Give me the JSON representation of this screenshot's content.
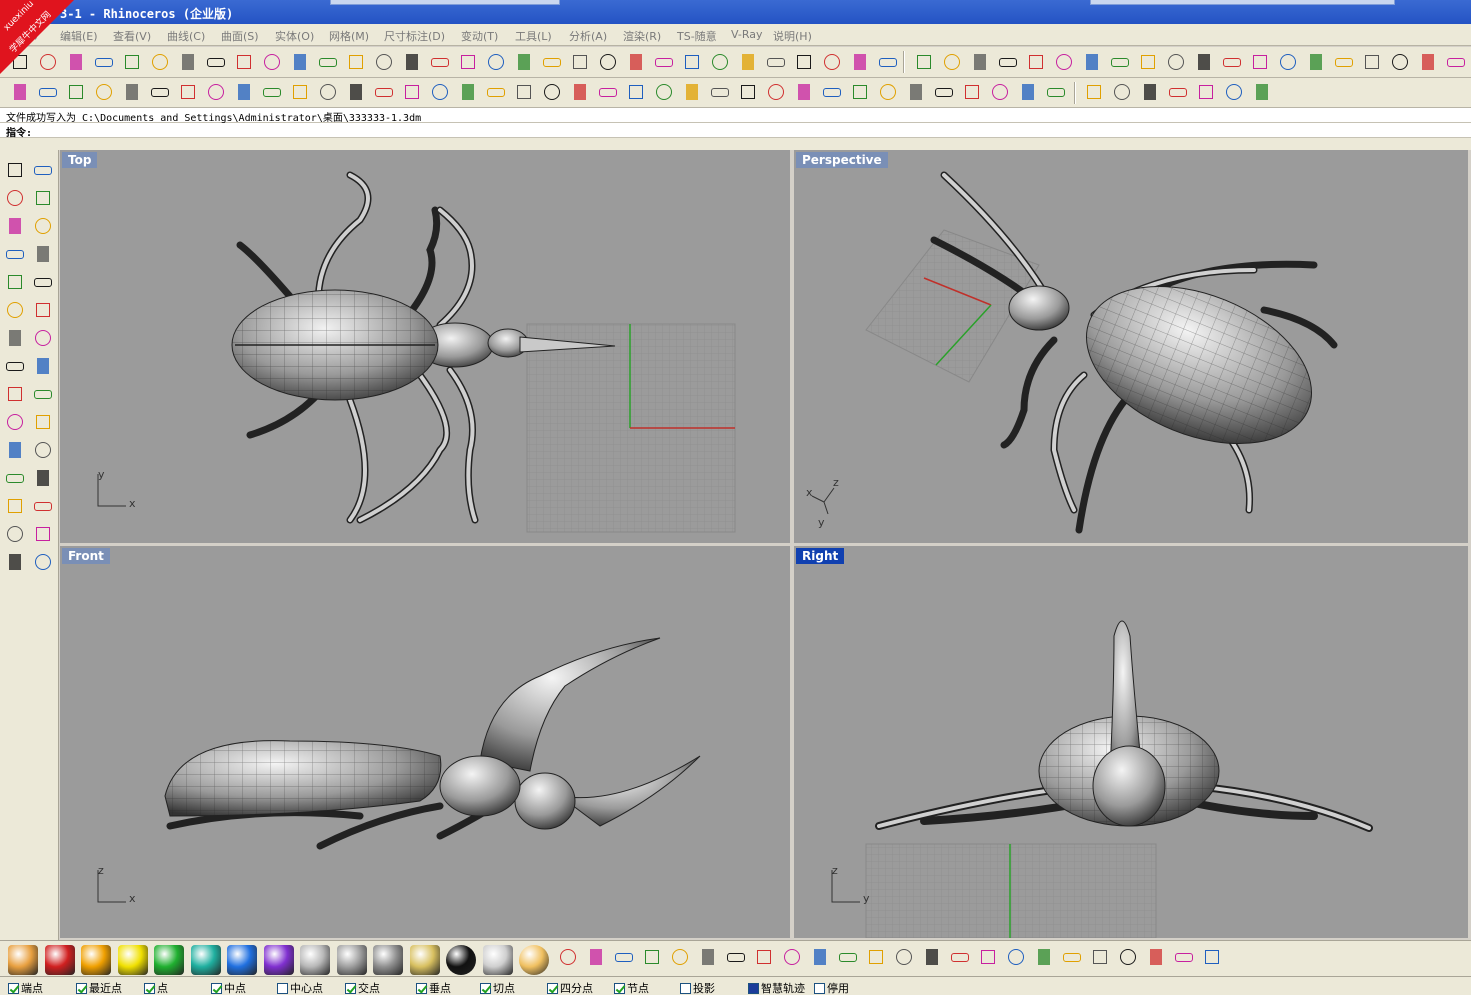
{
  "window": {
    "title": "3-1 - Rhinoceros (企业版)",
    "watermark": {
      "site": "xuexiniu",
      "name": "学犀牛中文网"
    }
  },
  "menu": [
    {
      "label": "编辑(E)"
    },
    {
      "label": "查看(V)"
    },
    {
      "label": "曲线(C)"
    },
    {
      "label": "曲面(S)"
    },
    {
      "label": "实体(O)"
    },
    {
      "label": "网格(M)"
    },
    {
      "label": "尺寸标注(D)"
    },
    {
      "label": "变动(T)"
    },
    {
      "label": "工具(L)"
    },
    {
      "label": "分析(A)"
    },
    {
      "label": "渲染(R)"
    },
    {
      "label": "TS-随意"
    },
    {
      "label": "V-Ray"
    },
    {
      "label": "说明(H)"
    }
  ],
  "command_history": "文件成功写入为 C:\\Documents and Settings\\Administrator\\桌面\\333333-1.3dm",
  "command_prompt": "指令:",
  "viewports": {
    "top": {
      "label": "Top",
      "axis_v": "y",
      "axis_h": "x"
    },
    "perspective": {
      "label": "Perspective",
      "axis_z": "z",
      "axis_x": "x",
      "axis_y": "y"
    },
    "front": {
      "label": "Front",
      "axis_v": "z",
      "axis_h": "x"
    },
    "right": {
      "label": "Right",
      "axis_v": "z",
      "axis_h": "y"
    }
  },
  "colors": {
    "viewport_bg": "#9b9b9b",
    "active_label": "#1040b0",
    "x_axis": "#c0302a",
    "y_axis": "#2aa12a"
  },
  "osnaps": [
    {
      "label": "端点",
      "checked": true
    },
    {
      "label": "最近点",
      "checked": true
    },
    {
      "label": "点",
      "checked": true
    },
    {
      "label": "中点",
      "checked": true
    },
    {
      "label": "中心点",
      "checked": false
    },
    {
      "label": "交点",
      "checked": true
    },
    {
      "label": "垂点",
      "checked": true
    },
    {
      "label": "切点",
      "checked": true
    },
    {
      "label": "四分点",
      "checked": true
    },
    {
      "label": "节点",
      "checked": true
    },
    {
      "label": "投影",
      "checked": false
    },
    {
      "label": "智慧轨迹",
      "checked": false
    },
    {
      "label": "停用",
      "checked": false
    }
  ]
}
